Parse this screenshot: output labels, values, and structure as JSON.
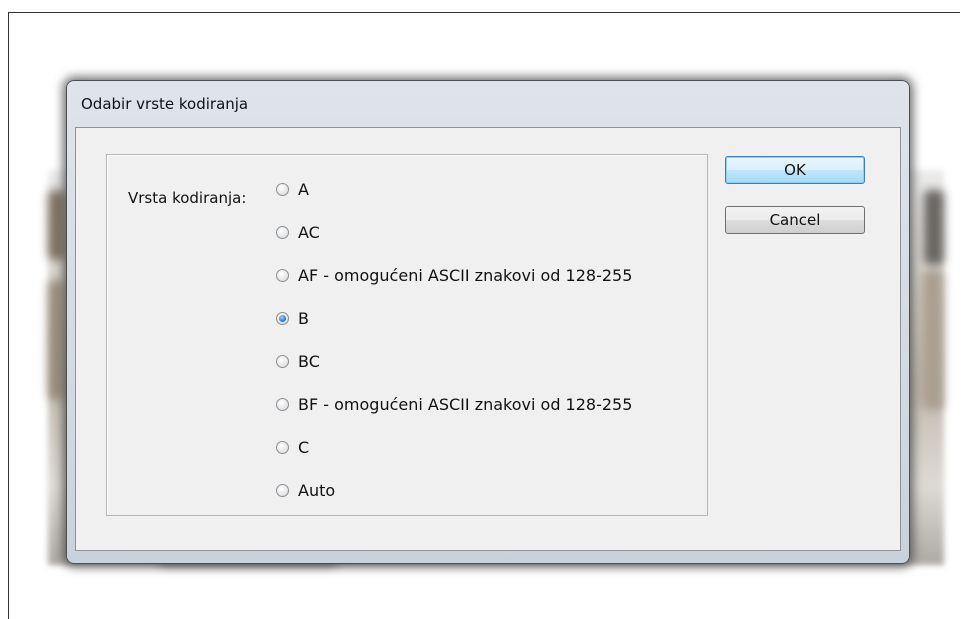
{
  "dialog": {
    "title": "Odabir vrste kodiranja",
    "encoding_label": "Vrsta kodiranja:",
    "selected": "B",
    "options": [
      {
        "label": "A",
        "checked": false
      },
      {
        "label": "AC",
        "checked": false
      },
      {
        "label": "AF - omogućeni ASCII znakovi od 128-255",
        "checked": false
      },
      {
        "label": "B",
        "checked": true
      },
      {
        "label": "BC",
        "checked": false
      },
      {
        "label": "BF - omogućeni ASCII znakovi od 128-255",
        "checked": false
      },
      {
        "label": "C",
        "checked": false
      },
      {
        "label": "Auto",
        "checked": false
      }
    ],
    "buttons": {
      "ok": "OK",
      "cancel": "Cancel"
    }
  },
  "colors": {
    "default_button_border": "#3c7fb1",
    "radio_checked": "#2a7fd4",
    "dialog_background": "#f0f0f0"
  }
}
